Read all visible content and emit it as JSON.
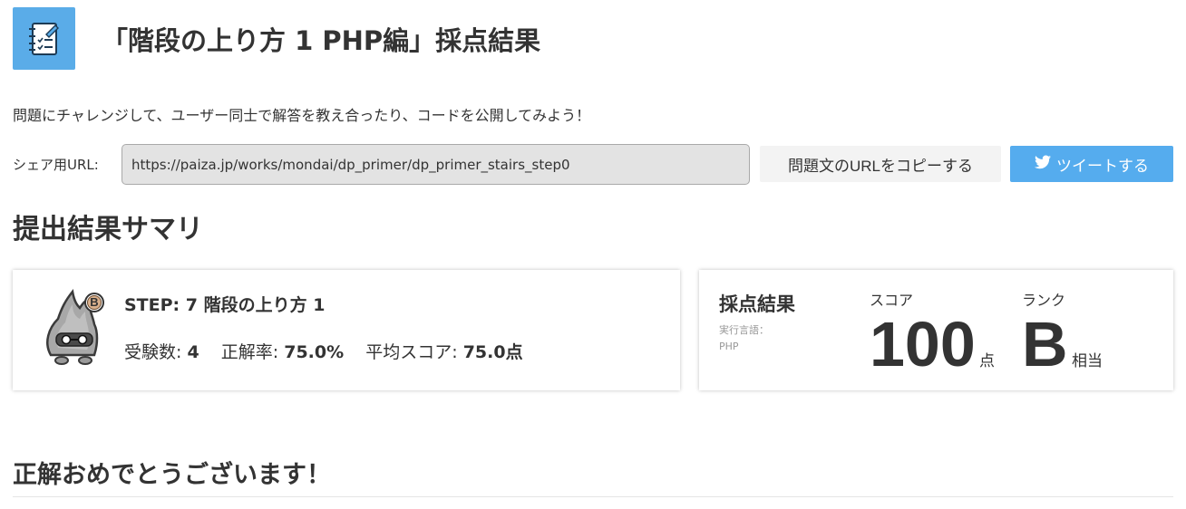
{
  "header": {
    "title": "「階段の上り方 1 PHP編」採点結果",
    "icon": "checklist-notebook-icon"
  },
  "intro": "問題にチャレンジして、ユーザー同士で解答を教え合ったり、コードを公開してみよう！",
  "share": {
    "label": "シェア用URL:",
    "url": "https://paiza.jp/works/mondai/dp_primer/dp_primer_stairs_step0",
    "copy_label": "問題文のURLをコピーする",
    "tweet_label": "ツイートする",
    "tweet_icon": "twitter-bird-icon"
  },
  "summary": {
    "heading": "提出結果サマリ",
    "step": {
      "title": "STEP: 7 階段の上り方 1",
      "badge": "B",
      "examinees_label": "受験数:",
      "examinees_value": "4",
      "accuracy_label": "正解率:",
      "accuracy_value": "75.0%",
      "average_label": "平均スコア:",
      "average_value": "75.0点"
    },
    "result": {
      "title": "採点結果",
      "lang_label": "実行言語：",
      "lang_value": "PHP",
      "score_label": "スコア",
      "score_value": "100",
      "score_unit": "点",
      "rank_label": "ランク",
      "rank_value": "B",
      "rank_unit": "相当"
    }
  },
  "congrats": "正解おめでとうございます！",
  "colors": {
    "accent": "#5aace8",
    "twitter": "#55acee",
    "text": "#333333",
    "muted": "#999999"
  }
}
